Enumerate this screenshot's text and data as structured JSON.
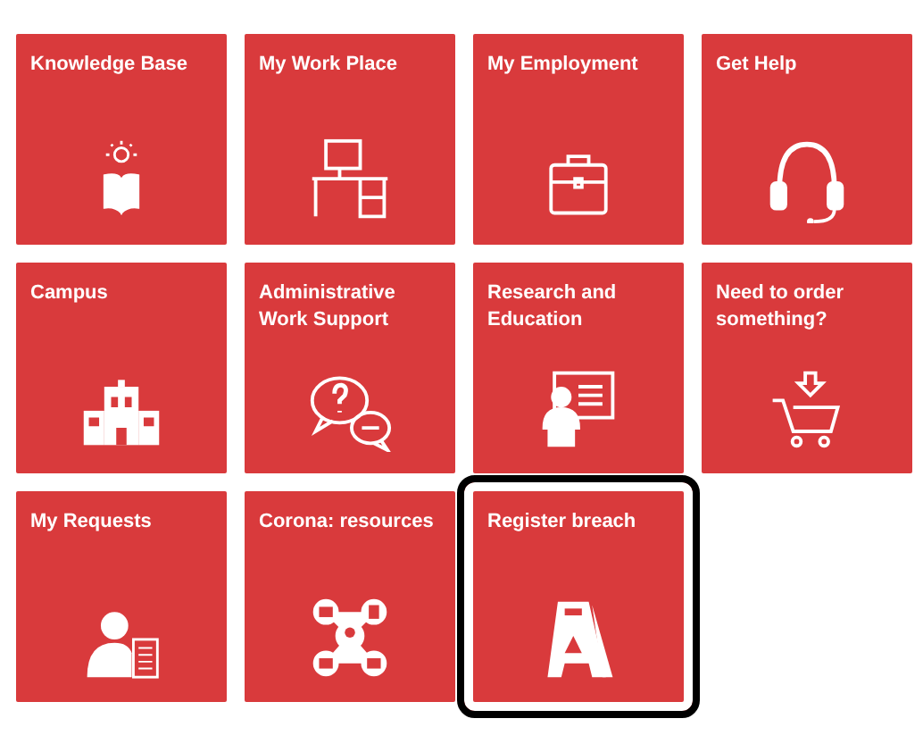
{
  "tiles": [
    {
      "label": "Knowledge Base",
      "kind": "book",
      "selected": false
    },
    {
      "label": "My Work Place",
      "kind": "desk",
      "selected": false
    },
    {
      "label": "My Employment",
      "kind": "briefcase",
      "selected": false
    },
    {
      "label": "Get Help",
      "kind": "headset",
      "selected": false
    },
    {
      "label": "Campus",
      "kind": "building",
      "selected": false
    },
    {
      "label": "Administrative Work Support",
      "kind": "chat",
      "selected": false
    },
    {
      "label": "Research and Education",
      "kind": "presentation",
      "selected": false
    },
    {
      "label": "Need to order something?",
      "kind": "cart",
      "selected": false
    },
    {
      "label": "My Requests",
      "kind": "person",
      "selected": false
    },
    {
      "label": "Corona: resources",
      "kind": "network",
      "selected": false
    },
    {
      "label": "Register breach",
      "kind": "sign",
      "selected": true
    }
  ]
}
